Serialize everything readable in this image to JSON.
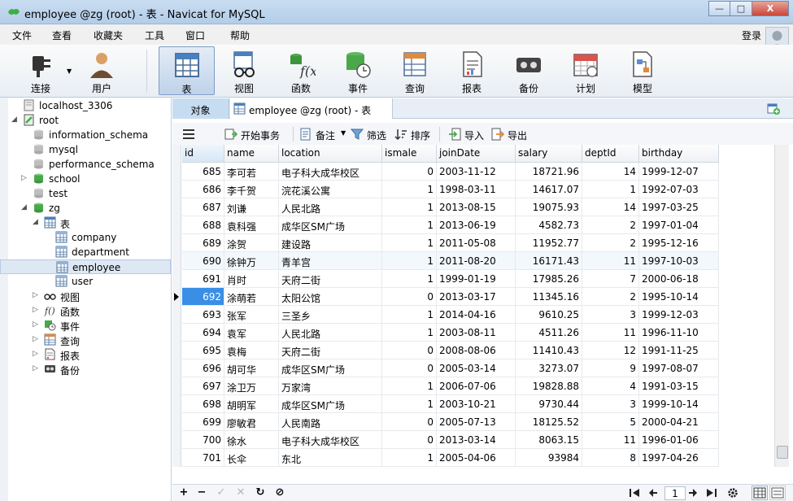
{
  "window": {
    "title": "employee @zg (root) - 表 - Navicat for MySQL",
    "controls": [
      "—",
      "□",
      "X"
    ]
  },
  "menu": {
    "items": [
      "文件",
      "查看",
      "收藏夹",
      "工具",
      "窗口",
      "帮助"
    ],
    "login": "登录"
  },
  "toolbar": {
    "buttons": [
      {
        "label": "连接",
        "icon": "plug-icon"
      },
      {
        "label": "用户",
        "icon": "user-icon"
      },
      {
        "label": "表",
        "icon": "table-icon"
      },
      {
        "label": "视图",
        "icon": "view-glasses-icon"
      },
      {
        "label": "函数",
        "icon": "function-icon"
      },
      {
        "label": "事件",
        "icon": "event-clock-icon"
      },
      {
        "label": "查询",
        "icon": "query-icon"
      },
      {
        "label": "报表",
        "icon": "report-icon"
      },
      {
        "label": "备份",
        "icon": "backup-icon"
      },
      {
        "label": "计划",
        "icon": "calendar-icon"
      },
      {
        "label": "模型",
        "icon": "model-icon"
      }
    ],
    "active": "表"
  },
  "sidebar": {
    "items": [
      {
        "label": "localhost_3306",
        "icon": "server-icon",
        "level": 0,
        "twisty": ""
      },
      {
        "label": "root",
        "icon": "server-active-icon",
        "level": 0,
        "twisty": "◢"
      },
      {
        "label": "information_schema",
        "icon": "database-icon",
        "level": 1,
        "twisty": ""
      },
      {
        "label": "mysql",
        "icon": "database-icon",
        "level": 1,
        "twisty": ""
      },
      {
        "label": "performance_schema",
        "icon": "database-icon",
        "level": 1,
        "twisty": ""
      },
      {
        "label": "school",
        "icon": "database-open-icon",
        "level": 1,
        "twisty": "▷"
      },
      {
        "label": "test",
        "icon": "database-icon",
        "level": 1,
        "twisty": ""
      },
      {
        "label": "zg",
        "icon": "database-open-icon",
        "level": 1,
        "twisty": "◢"
      },
      {
        "label": "表",
        "icon": "tables-folder-icon",
        "level": 2,
        "twisty": "◢"
      },
      {
        "label": "company",
        "icon": "table-icon",
        "level": 3,
        "twisty": ""
      },
      {
        "label": "department",
        "icon": "table-icon",
        "level": 3,
        "twisty": ""
      },
      {
        "label": "employee",
        "icon": "table-icon",
        "level": 3,
        "twisty": "",
        "selected": true
      },
      {
        "label": "user",
        "icon": "table-icon",
        "level": 3,
        "twisty": ""
      },
      {
        "label": "视图",
        "icon": "view-glasses-icon",
        "level": 2,
        "twisty": "▷"
      },
      {
        "label": "函数",
        "icon": "function-icon",
        "level": 2,
        "twisty": "▷"
      },
      {
        "label": "事件",
        "icon": "event-clock-icon",
        "level": 2,
        "twisty": "▷"
      },
      {
        "label": "查询",
        "icon": "query-icon",
        "level": 2,
        "twisty": "▷"
      },
      {
        "label": "报表",
        "icon": "report-icon",
        "level": 2,
        "twisty": "▷"
      },
      {
        "label": "备份",
        "icon": "backup-icon",
        "level": 2,
        "twisty": "▷"
      }
    ]
  },
  "tabs": {
    "objects": "对象",
    "current": "employee @zg (root) - 表"
  },
  "grid_tools": {
    "begin_transaction": "开始事务",
    "memo": "备注",
    "filter": "筛选",
    "sort": "排序",
    "import": "导入",
    "export": "导出"
  },
  "table": {
    "columns": [
      "id",
      "name",
      "location",
      "ismale",
      "joinDate",
      "salary",
      "deptId",
      "birthday"
    ],
    "numeric_columns": [
      "id",
      "ismale",
      "salary",
      "deptId"
    ],
    "rows": [
      [
        "685",
        "李可若",
        "电子科大成华校区",
        "0",
        "2003-11-12",
        "18721.96",
        "14",
        "1999-12-07"
      ],
      [
        "686",
        "李千贺",
        "浣花溪公寓",
        "1",
        "1998-03-11",
        "14617.07",
        "1",
        "1992-07-03"
      ],
      [
        "687",
        "刘谦",
        "人民北路",
        "1",
        "2013-08-15",
        "19075.93",
        "14",
        "1997-03-25"
      ],
      [
        "688",
        "袁科强",
        "成华区SM广场",
        "1",
        "2013-06-19",
        "4582.73",
        "2",
        "1997-01-04"
      ],
      [
        "689",
        "涂贺",
        "建设路",
        "1",
        "2011-05-08",
        "11952.77",
        "2",
        "1995-12-16"
      ],
      [
        "690",
        "徐钟万",
        "青羊宫",
        "1",
        "2011-08-20",
        "16171.43",
        "11",
        "1997-10-03"
      ],
      [
        "691",
        "肖时",
        "天府二街",
        "1",
        "1999-01-19",
        "17985.26",
        "7",
        "2000-06-18"
      ],
      [
        "692",
        "涂萌若",
        "太阳公馆",
        "0",
        "2013-03-17",
        "11345.16",
        "2",
        "1995-10-14"
      ],
      [
        "693",
        "张军",
        "三圣乡",
        "1",
        "2014-04-16",
        "9610.25",
        "3",
        "1999-12-03"
      ],
      [
        "694",
        "袁军",
        "人民北路",
        "1",
        "2003-08-11",
        "4511.26",
        "11",
        "1996-11-10"
      ],
      [
        "695",
        "袁梅",
        "天府二街",
        "0",
        "2008-08-06",
        "11410.43",
        "12",
        "1991-11-25"
      ],
      [
        "696",
        "胡可华",
        "成华区SM广场",
        "0",
        "2005-03-14",
        "3273.07",
        "9",
        "1997-08-07"
      ],
      [
        "697",
        "涂卫万",
        "万家湾",
        "1",
        "2006-07-06",
        "19828.88",
        "4",
        "1991-03-15"
      ],
      [
        "698",
        "胡明军",
        "成华区SM广场",
        "1",
        "2003-10-21",
        "9730.44",
        "3",
        "1999-10-14"
      ],
      [
        "699",
        "廖敏君",
        "人民南路",
        "0",
        "2005-07-13",
        "18125.52",
        "5",
        "2000-04-21"
      ],
      [
        "700",
        "徐水",
        "电子科大成华校区",
        "0",
        "2013-03-14",
        "8063.15",
        "11",
        "1996-01-06"
      ],
      [
        "701",
        "长伞",
        "东北",
        "1",
        "2005-04-06",
        "93984",
        "8",
        "1997-04-26"
      ]
    ],
    "selected_row_index": 7,
    "alt_row_index": 5
  },
  "pagination": {
    "page": "1"
  },
  "bottom_controls": [
    "+",
    "−",
    "✓",
    "✕",
    "↻",
    "⊘"
  ],
  "colors": {
    "accent": "#3a8ee6",
    "titlebar": "#c1d6ee",
    "selection_bg": "#dde8f4"
  }
}
